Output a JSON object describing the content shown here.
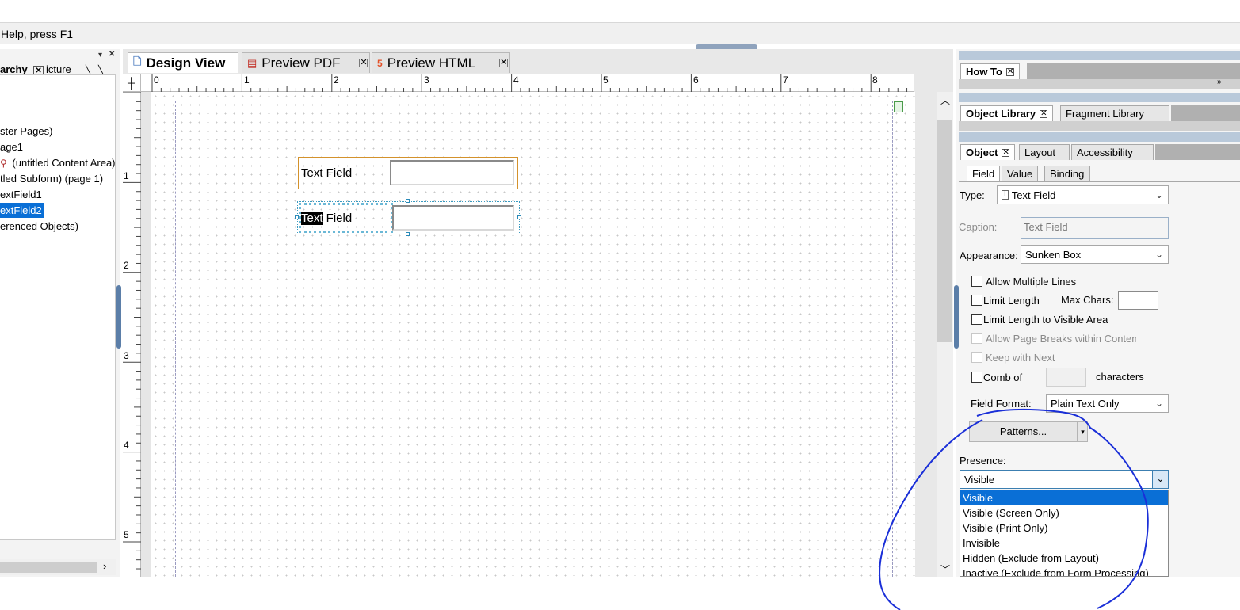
{
  "status_bar": {
    "text": "Help, press F1"
  },
  "hierarchy_panel": {
    "tabs": [
      "archy",
      "icture"
    ],
    "tree": [
      {
        "label": "ster Pages)",
        "selected": false
      },
      {
        "label": "age1",
        "selected": false
      },
      {
        "label": "(untitled Content Area)",
        "selected": false
      },
      {
        "label": "tled Subform) (page 1)",
        "selected": false
      },
      {
        "label": "extField1",
        "selected": false
      },
      {
        "label": "extField2",
        "selected": true
      },
      {
        "label": "erenced Objects)",
        "selected": false
      }
    ]
  },
  "doc_tabs": [
    {
      "label": "Design View",
      "active": true,
      "icon": "page-icon"
    },
    {
      "label": "Preview PDF",
      "active": false,
      "icon": "pdf-icon"
    },
    {
      "label": "Preview HTML",
      "active": false,
      "icon": "html5-icon"
    }
  ],
  "ruler": {
    "top_marks": [
      "0",
      "1",
      "2",
      "3",
      "4",
      "5",
      "6",
      "7",
      "8"
    ],
    "left_marks": [
      "1",
      "2",
      "3",
      "4",
      "5"
    ]
  },
  "canvas": {
    "field1": {
      "caption": "Text Field"
    },
    "field2": {
      "caption_highlight": "Text",
      "caption_rest": " Field"
    }
  },
  "how_to": {
    "tab": "How To"
  },
  "library": {
    "tabs": [
      "Object Library",
      "Fragment Library"
    ]
  },
  "object_panel": {
    "tabs": [
      "Object",
      "Layout",
      "Accessibility"
    ],
    "subtabs": [
      "Field",
      "Value",
      "Binding"
    ],
    "type_label": "Type:",
    "type_value": "Text Field",
    "caption_label": "Caption:",
    "caption_value": "Text Field",
    "appearance_label": "Appearance:",
    "appearance_value": "Sunken Box",
    "allow_multiple_lines": "Allow Multiple Lines",
    "limit_length": "Limit Length",
    "max_chars_label": "Max Chars:",
    "limit_visible": "Limit Length to Visible Area",
    "allow_page_breaks": "Allow Page Breaks within Content",
    "keep_with_next": "Keep with Next",
    "comb_of": "Comb of",
    "characters": "characters",
    "field_format_label": "Field Format:",
    "field_format_value": "Plain Text Only",
    "patterns_button": "Patterns...",
    "presence_label": "Presence:",
    "presence_value": "Visible",
    "presence_options": [
      "Visible",
      "Visible (Screen Only)",
      "Visible (Print Only)",
      "Invisible",
      "Hidden (Exclude from Layout)",
      "Inactive (Exclude from Form Processing)"
    ]
  },
  "colors": {
    "selection": "#0a6fd6",
    "field_border": "#d4922c",
    "annotation_ink": "#1a2fd8"
  }
}
